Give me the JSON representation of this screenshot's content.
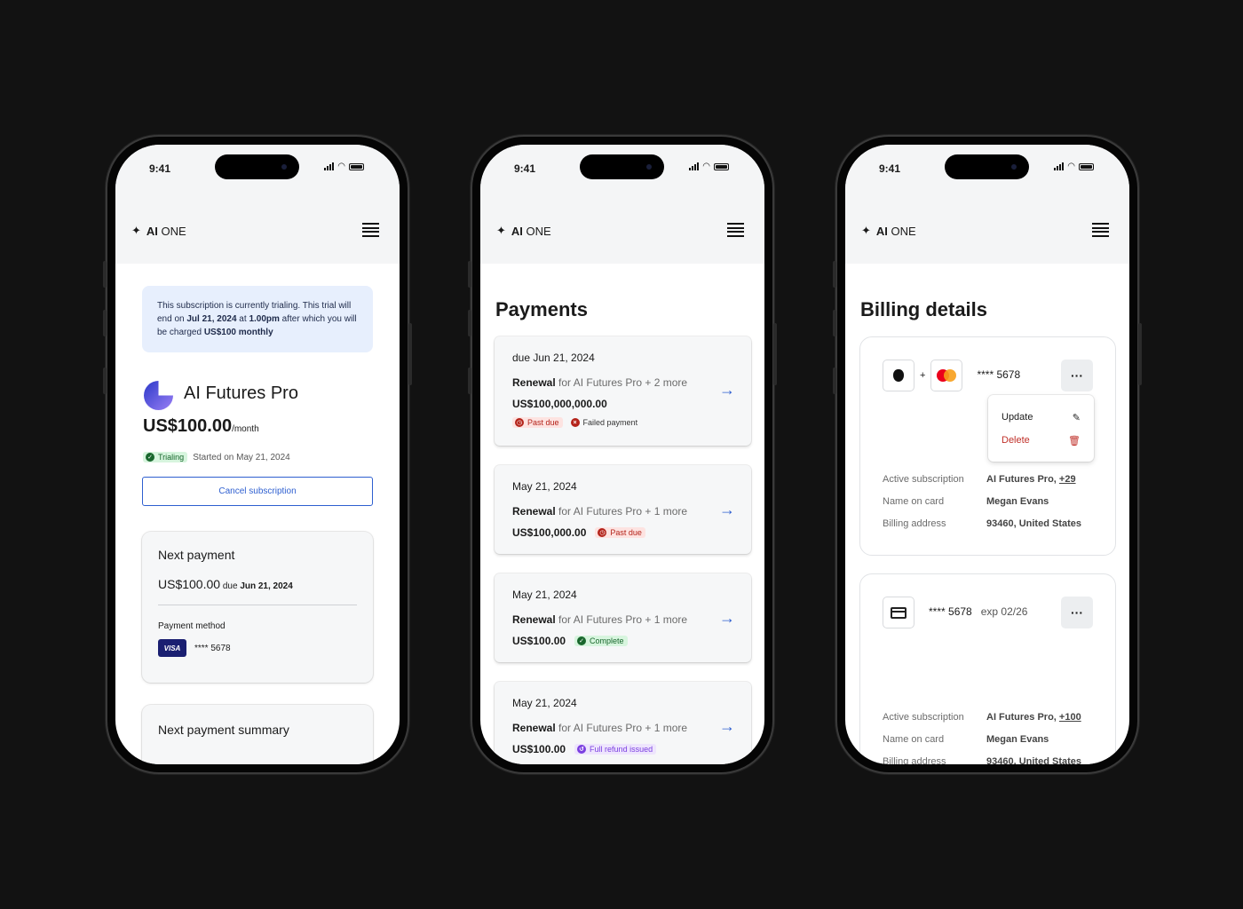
{
  "status_bar": {
    "time": "9:41"
  },
  "brand": {
    "bold": "AI",
    "rest": " ONE"
  },
  "screen1": {
    "notice": {
      "part1": "This subscription is currently trialing. This trial will end on ",
      "date": "Jul 21, 2024",
      "part2": " at ",
      "time": "1.00pm",
      "part3": " after which you will be charged ",
      "charge": "US$100 monthly"
    },
    "plan_name": "AI Futures Pro",
    "price": "US$100.00",
    "price_unit": "/month",
    "status_badge": "Trialing",
    "started": "Started on May 21, 2024",
    "cancel_label": "Cancel subscription",
    "next_payment": {
      "title": "Next payment",
      "amount": "US$100.00",
      "due_prefix": " due ",
      "due_date": "Jun 21, 2024",
      "method_label": "Payment method",
      "card_brand": "VISA",
      "card_num": "**** 5678"
    },
    "summary_title": "Next payment summary"
  },
  "screen2": {
    "title": "Payments",
    "payments": [
      {
        "date": "due Jun 21, 2024",
        "type": "Renewal",
        "desc": " for AI Futures Pro + 2 more",
        "amount": "US$100,000,000.00",
        "badges": [
          "Past due",
          "Failed payment"
        ]
      },
      {
        "date": "May 21, 2024",
        "type": "Renewal",
        "desc": " for AI Futures Pro + 1 more",
        "amount": "US$100,000.00",
        "badges": [
          "Past due"
        ]
      },
      {
        "date": "May 21, 2024",
        "type": "Renewal",
        "desc": " for AI Futures Pro + 1 more",
        "amount": "US$100.00",
        "badges": [
          "Complete"
        ]
      },
      {
        "date": "May 21, 2024",
        "type": "Renewal",
        "desc": " for AI Futures Pro + 1 more",
        "amount": "US$100.00",
        "badges": [
          "Full refund issued"
        ]
      }
    ]
  },
  "screen3": {
    "title": "Billing details",
    "cards": [
      {
        "num": "**** 5678",
        "menu": {
          "update": "Update",
          "delete": "Delete"
        },
        "labels": [
          "Active subscription",
          "Name on card",
          "Billing address"
        ],
        "sub_name": "AI Futures Pro, ",
        "sub_more": "+29",
        "name": "Megan Evans",
        "address": "93460, United States"
      },
      {
        "num": "**** 5678",
        "exp": "exp 02/26",
        "labels": [
          "Active subscription",
          "Name on card",
          "Billing address"
        ],
        "sub_name": "AI Futures Pro, ",
        "sub_more": "+100",
        "name": "Megan Evans",
        "address": "93460, United States"
      }
    ],
    "plus": "+",
    "dots": "···"
  },
  "colors": {
    "accent": "#2e5fd0",
    "notice_bg": "#e7effd",
    "danger": "#c0312a",
    "success": "#19672d"
  }
}
